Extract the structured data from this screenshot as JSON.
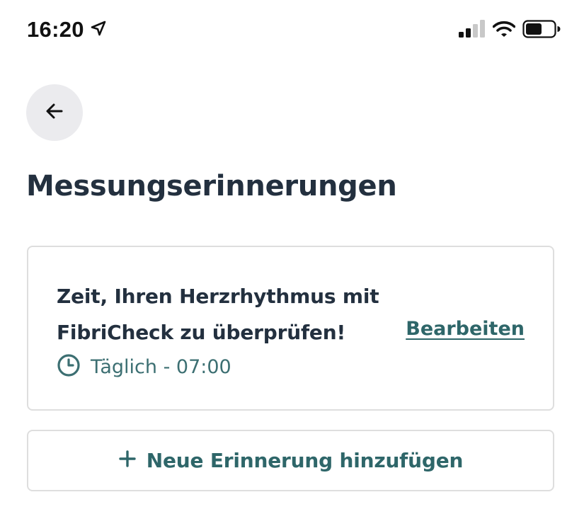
{
  "status_bar": {
    "time": "16:20",
    "icons": [
      "location-arrow-icon",
      "cellular-signal-icon",
      "wifi-icon",
      "battery-icon"
    ]
  },
  "navigation": {
    "back_icon": "arrow-left-icon"
  },
  "page": {
    "title": "Messungserinnerungen"
  },
  "reminders": [
    {
      "message": "Zeit, Ihren Herzrhythmus mit FibriCheck zu überprüfen!",
      "schedule": "Täglich - 07:00",
      "edit_label": "Bearbeiten",
      "icon": "clock-icon"
    }
  ],
  "add_reminder": {
    "label": "Neue Erinnerung hinzufügen",
    "icon": "plus-icon"
  },
  "colors": {
    "title": "#23303f",
    "accent": "#2e6669",
    "card_border": "#dedede",
    "back_button_bg": "#ebebee"
  }
}
